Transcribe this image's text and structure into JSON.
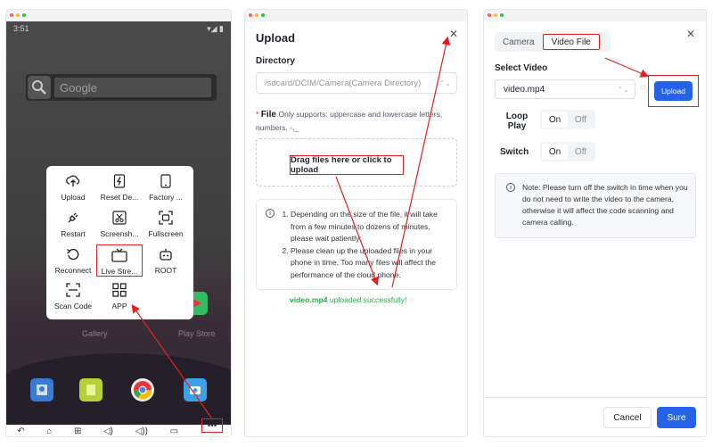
{
  "colors": {
    "accent": "#2463e8",
    "highlight": "#e02020",
    "success": "#2ba84a",
    "mac_red": "#ff5f56",
    "mac_yellow": "#ffbd2e",
    "mac_green": "#27c93f"
  },
  "phone": {
    "status_time": "3:51",
    "search_placeholder": "Google",
    "menu_items": [
      {
        "label": "Upload",
        "icon": "cloud-upload-icon"
      },
      {
        "label": "Reset De...",
        "icon": "flash-icon"
      },
      {
        "label": "Factory ...",
        "icon": "phone-icon"
      },
      {
        "label": "Restart",
        "icon": "plug-icon"
      },
      {
        "label": "Screensh...",
        "icon": "scissors-icon"
      },
      {
        "label": "Fullscreen",
        "icon": "fullscreen-icon"
      },
      {
        "label": "Reconnect",
        "icon": "reconnect-icon"
      },
      {
        "label": "Live Stre...",
        "icon": "tv-icon"
      },
      {
        "label": "ROOT",
        "icon": "robot-icon"
      },
      {
        "label": "Scan Code",
        "icon": "scan-icon"
      },
      {
        "label": "APP",
        "icon": "grid-icon"
      }
    ],
    "apps": {
      "gallery": "Gallery",
      "play_store": "Play Store"
    },
    "nav": [
      "back-icon",
      "home-icon",
      "apps-icon",
      "volume-down-icon",
      "volume-up-icon",
      "screen-icon",
      "more-icon"
    ]
  },
  "upload": {
    "title": "Upload",
    "directory_label": "Directory",
    "directory_value": "/sdcard/DCIM/Camera(Camera Directory)",
    "file_required": "*",
    "file_label": "File",
    "file_hint": "Only supports: uppercase and lowercase letters, numbers, -,_",
    "dropzone_label": "Drag files here or click to upload",
    "notes": [
      "Depending on the size of the file, it will take from a few minutes to dozens of minutes, please wait patiently;",
      "Please clean up the uploaded files in your phone in time. Too many files will affect the performance of the cloud phone."
    ],
    "success_file": "video.mp4",
    "success_text": "uploaded successfully!"
  },
  "camera": {
    "tabs": [
      "Camera",
      "Video File"
    ],
    "select_video_label": "Select Video",
    "select_value": "video.mp4",
    "upload_button": "Upload",
    "loop_play_label": "Loop Play",
    "switch_label": "Switch",
    "on": "On",
    "off": "Off",
    "note": "Note: Please turn off the switch in time when you do not need to write the video to the camera, otherwise it will affect the code scanning and camera calling.",
    "cancel": "Cancel",
    "sure": "Sure"
  }
}
